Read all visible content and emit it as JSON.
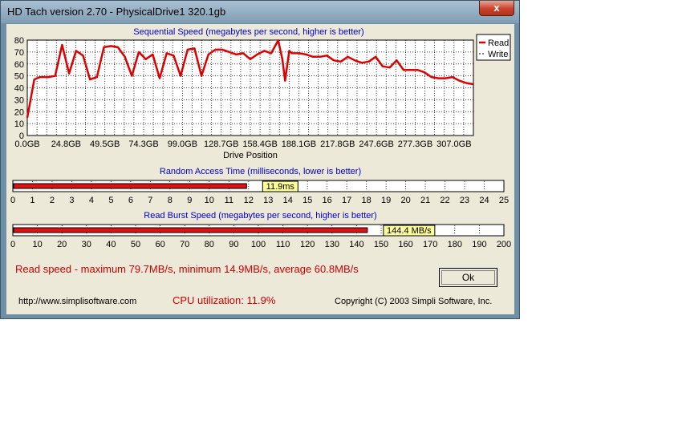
{
  "window": {
    "title": "HD Tach version 2.70 - PhysicalDrive1 320.1gb",
    "close_glyph": "x"
  },
  "sequential": {
    "caption": "Sequential Speed (megabytes per second, higher is better)",
    "xlabel": "Drive Position",
    "legend": {
      "read": "Read",
      "write": "Write"
    }
  },
  "chart_data": {
    "type": "line",
    "title": "Sequential Speed (megabytes per second, higher is better)",
    "xlabel": "Drive Position",
    "ylabel": "",
    "ylim": [
      0,
      80
    ],
    "yticks": [
      "0",
      "10",
      "20",
      "30",
      "40",
      "50",
      "60",
      "70",
      "80"
    ],
    "xticks": [
      "0.0GB",
      "24.8GB",
      "49.5GB",
      "74.3GB",
      "99.0GB",
      "128.7GB",
      "158.4GB",
      "188.1GB",
      "217.8GB",
      "247.6GB",
      "277.3GB",
      "307.0GB"
    ],
    "xlim": [
      0,
      320.1
    ],
    "legend_position": "right",
    "grid": true,
    "series": [
      {
        "name": "Read",
        "color": "#dd0000",
        "x": [
          0,
          5,
          9,
          15,
          20,
          25,
          30,
          35,
          40,
          45,
          50,
          55,
          60,
          65,
          70,
          75,
          80,
          85,
          90,
          95,
          100,
          105,
          110,
          115,
          120,
          125,
          130,
          135,
          140,
          145,
          150,
          155,
          160,
          165,
          170,
          175,
          180,
          183,
          185,
          188,
          190,
          195,
          200,
          205,
          210,
          215,
          220,
          225,
          230,
          235,
          240,
          245,
          250,
          255,
          260,
          265,
          270,
          275,
          280,
          285,
          290,
          295,
          300,
          305,
          310,
          315,
          320
        ],
        "values": [
          14.9,
          47,
          49,
          49,
          50,
          76,
          52,
          71,
          67,
          47,
          49,
          74,
          75,
          74,
          66,
          50,
          70,
          64,
          68,
          48,
          69,
          67,
          50,
          72,
          73,
          50,
          68,
          72,
          72,
          70,
          68,
          69,
          64,
          68,
          71,
          69,
          79.7,
          64,
          46,
          71,
          69,
          69,
          68,
          66,
          66,
          67,
          63,
          62,
          66,
          63,
          61,
          62,
          66,
          58,
          57,
          63,
          55,
          55,
          55,
          53,
          49,
          48,
          48,
          49,
          46,
          44,
          43
        ]
      },
      {
        "name": "Write",
        "color": "#000000",
        "x": [],
        "values": []
      }
    ]
  },
  "random_access": {
    "caption": "Random Access Time (milliseconds, lower is better)",
    "value_label": "11.9ms",
    "value": 11.9,
    "max": 25,
    "ticks": [
      "0",
      "1",
      "2",
      "3",
      "4",
      "5",
      "6",
      "7",
      "8",
      "9",
      "10",
      "11",
      "12",
      "13",
      "14",
      "15",
      "16",
      "17",
      "18",
      "19",
      "20",
      "21",
      "22",
      "23",
      "24",
      "25"
    ]
  },
  "burst": {
    "caption": "Read Burst Speed (megabytes per second, higher is better)",
    "value_label": "144.4 MB/s",
    "value": 144.4,
    "max": 200,
    "ticks": [
      "0",
      "10",
      "20",
      "30",
      "40",
      "50",
      "60",
      "70",
      "80",
      "90",
      "100",
      "110",
      "120",
      "130",
      "140",
      "150",
      "160",
      "170",
      "180",
      "190",
      "200"
    ]
  },
  "summary": {
    "read_speed": "Read speed - maximum 79.7MB/s, minimum 14.9MB/s, average 60.8MB/s",
    "cpu": "CPU utilization: 11.9%"
  },
  "footer": {
    "url": "http://www.simplisoftware.com",
    "copyright": "Copyright (C) 2003 Simpli Software, Inc."
  },
  "buttons": {
    "ok": "Ok"
  }
}
